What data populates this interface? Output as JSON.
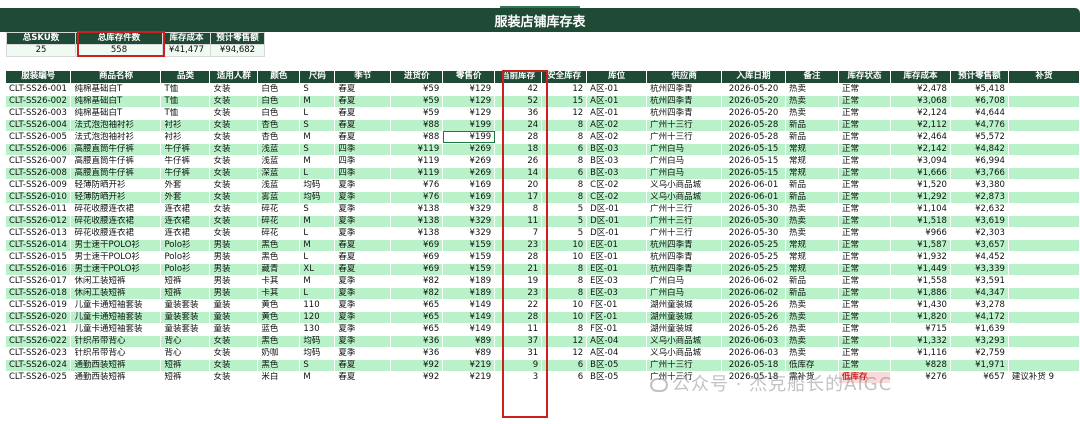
{
  "title": "服装店铺库存表",
  "summary": {
    "headers": [
      "总SKU数",
      "总库存件数",
      "库存成本",
      "预计零售额"
    ],
    "values": [
      "25",
      "558",
      "¥41,477",
      "¥94,682"
    ]
  },
  "columns": [
    "服装编号",
    "商品名称",
    "品类",
    "适用人群",
    "颜色",
    "尺码",
    "季节",
    "进货价",
    "零售价",
    "当前库存",
    "安全库存",
    "库位",
    "供应商",
    "入库日期",
    "备注",
    "库存状态",
    "库存成本",
    "预计零售额",
    "补货"
  ],
  "rows": [
    [
      "CLT-SS26-001",
      "纯棉基础白T",
      "T恤",
      "女装",
      "白色",
      "S",
      "春夏",
      "¥59",
      "¥129",
      "42",
      "12",
      "A区-01",
      "杭州四季青",
      "2026-05-20",
      "热卖",
      "正常",
      "¥2,478",
      "¥5,418",
      ""
    ],
    [
      "CLT-SS26-002",
      "纯棉基础白T",
      "T恤",
      "女装",
      "白色",
      "M",
      "春夏",
      "¥59",
      "¥129",
      "52",
      "15",
      "A区-01",
      "杭州四季青",
      "2026-05-20",
      "热卖",
      "正常",
      "¥3,068",
      "¥6,708",
      ""
    ],
    [
      "CLT-SS26-003",
      "纯棉基础白T",
      "T恤",
      "女装",
      "白色",
      "L",
      "春夏",
      "¥59",
      "¥129",
      "36",
      "12",
      "A区-01",
      "杭州四季青",
      "2026-05-20",
      "热卖",
      "正常",
      "¥2,124",
      "¥4,644",
      ""
    ],
    [
      "CLT-SS26-004",
      "法式泡泡袖衬衫",
      "衬衫",
      "女装",
      "杏色",
      "S",
      "春夏",
      "¥88",
      "¥199",
      "24",
      "8",
      "A区-02",
      "广州十三行",
      "2026-05-28",
      "新品",
      "正常",
      "¥2,112",
      "¥4,776",
      ""
    ],
    [
      "CLT-SS26-005",
      "法式泡泡袖衬衫",
      "衬衫",
      "女装",
      "杏色",
      "M",
      "春夏",
      "¥88",
      "¥199",
      "28",
      "8",
      "A区-02",
      "广州十三行",
      "2026-05-28",
      "新品",
      "正常",
      "¥2,464",
      "¥5,572",
      ""
    ],
    [
      "CLT-SS26-006",
      "高腰直筒牛仔裤",
      "牛仔裤",
      "女装",
      "浅蓝",
      "S",
      "四季",
      "¥119",
      "¥269",
      "18",
      "6",
      "B区-03",
      "广州白马",
      "2026-05-15",
      "常规",
      "正常",
      "¥2,142",
      "¥4,842",
      ""
    ],
    [
      "CLT-SS26-007",
      "高腰直筒牛仔裤",
      "牛仔裤",
      "女装",
      "浅蓝",
      "M",
      "四季",
      "¥119",
      "¥269",
      "26",
      "8",
      "B区-03",
      "广州白马",
      "2026-05-15",
      "常规",
      "正常",
      "¥3,094",
      "¥6,994",
      ""
    ],
    [
      "CLT-SS26-008",
      "高腰直筒牛仔裤",
      "牛仔裤",
      "女装",
      "深蓝",
      "L",
      "四季",
      "¥119",
      "¥269",
      "14",
      "6",
      "B区-03",
      "广州白马",
      "2026-05-15",
      "常规",
      "正常",
      "¥1,666",
      "¥3,766",
      ""
    ],
    [
      "CLT-SS26-009",
      "轻薄防晒开衫",
      "外套",
      "女装",
      "浅蓝",
      "均码",
      "夏季",
      "¥76",
      "¥169",
      "20",
      "8",
      "C区-02",
      "义乌小商品城",
      "2026-06-01",
      "新品",
      "正常",
      "¥1,520",
      "¥3,380",
      ""
    ],
    [
      "CLT-SS26-010",
      "轻薄防晒开衫",
      "外套",
      "女装",
      "雾蓝",
      "均码",
      "夏季",
      "¥76",
      "¥169",
      "17",
      "8",
      "C区-02",
      "义乌小商品城",
      "2026-06-01",
      "新品",
      "正常",
      "¥1,292",
      "¥2,873",
      ""
    ],
    [
      "CLT-SS26-011",
      "碎花收腰连衣裙",
      "连衣裙",
      "女装",
      "碎花",
      "S",
      "夏季",
      "¥138",
      "¥329",
      "8",
      "5",
      "D区-01",
      "广州十三行",
      "2026-05-30",
      "热卖",
      "正常",
      "¥1,104",
      "¥2,632",
      ""
    ],
    [
      "CLT-SS26-012",
      "碎花收腰连衣裙",
      "连衣裙",
      "女装",
      "碎花",
      "M",
      "夏季",
      "¥138",
      "¥329",
      "11",
      "5",
      "D区-01",
      "广州十三行",
      "2026-05-30",
      "热卖",
      "正常",
      "¥1,518",
      "¥3,619",
      ""
    ],
    [
      "CLT-SS26-013",
      "碎花收腰连衣裙",
      "连衣裙",
      "女装",
      "碎花",
      "L",
      "夏季",
      "¥138",
      "¥329",
      "7",
      "5",
      "D区-01",
      "广州十三行",
      "2026-05-30",
      "热卖",
      "正常",
      "¥966",
      "¥2,303",
      ""
    ],
    [
      "CLT-SS26-014",
      "男士速干POLO衫",
      "Polo衫",
      "男装",
      "黑色",
      "M",
      "春夏",
      "¥69",
      "¥159",
      "23",
      "10",
      "E区-01",
      "杭州四季青",
      "2026-05-25",
      "常规",
      "正常",
      "¥1,587",
      "¥3,657",
      ""
    ],
    [
      "CLT-SS26-015",
      "男士速干POLO衫",
      "Polo衫",
      "男装",
      "黑色",
      "L",
      "春夏",
      "¥69",
      "¥159",
      "28",
      "10",
      "E区-01",
      "杭州四季青",
      "2026-05-25",
      "常规",
      "正常",
      "¥1,932",
      "¥4,452",
      ""
    ],
    [
      "CLT-SS26-016",
      "男士速干POLO衫",
      "Polo衫",
      "男装",
      "藏青",
      "XL",
      "春夏",
      "¥69",
      "¥159",
      "21",
      "8",
      "E区-01",
      "杭州四季青",
      "2026-05-25",
      "常规",
      "正常",
      "¥1,449",
      "¥3,339",
      ""
    ],
    [
      "CLT-SS26-017",
      "休闲工装短裤",
      "短裤",
      "男装",
      "卡其",
      "M",
      "夏季",
      "¥82",
      "¥189",
      "19",
      "8",
      "E区-03",
      "广州白马",
      "2026-06-02",
      "新品",
      "正常",
      "¥1,558",
      "¥3,591",
      ""
    ],
    [
      "CLT-SS26-018",
      "休闲工装短裤",
      "短裤",
      "男装",
      "卡其",
      "L",
      "夏季",
      "¥82",
      "¥189",
      "23",
      "8",
      "E区-03",
      "广州白马",
      "2026-06-02",
      "新品",
      "正常",
      "¥1,886",
      "¥4,347",
      ""
    ],
    [
      "CLT-SS26-019",
      "儿童卡通短袖套装",
      "童装套装",
      "童装",
      "黄色",
      "110",
      "夏季",
      "¥65",
      "¥149",
      "22",
      "10",
      "F区-01",
      "湖州童装城",
      "2026-05-26",
      "热卖",
      "正常",
      "¥1,430",
      "¥3,278",
      ""
    ],
    [
      "CLT-SS26-020",
      "儿童卡通短袖套装",
      "童装套装",
      "童装",
      "黄色",
      "120",
      "夏季",
      "¥65",
      "¥149",
      "28",
      "10",
      "F区-01",
      "湖州童装城",
      "2026-05-26",
      "热卖",
      "正常",
      "¥1,820",
      "¥4,172",
      ""
    ],
    [
      "CLT-SS26-021",
      "儿童卡通短袖套装",
      "童装套装",
      "童装",
      "蓝色",
      "130",
      "夏季",
      "¥65",
      "¥149",
      "11",
      "8",
      "F区-01",
      "湖州童装城",
      "2026-05-26",
      "热卖",
      "正常",
      "¥715",
      "¥1,639",
      ""
    ],
    [
      "CLT-SS26-022",
      "针织吊带背心",
      "背心",
      "女装",
      "黑色",
      "均码",
      "夏季",
      "¥36",
      "¥89",
      "37",
      "12",
      "A区-04",
      "义乌小商品城",
      "2026-06-03",
      "热卖",
      "正常",
      "¥1,332",
      "¥3,293",
      ""
    ],
    [
      "CLT-SS26-023",
      "针织吊带背心",
      "背心",
      "女装",
      "奶咖",
      "均码",
      "夏季",
      "¥36",
      "¥89",
      "31",
      "12",
      "A区-04",
      "义乌小商品城",
      "2026-06-03",
      "热卖",
      "正常",
      "¥1,116",
      "¥2,759",
      ""
    ],
    [
      "CLT-SS26-024",
      "通勤西装短裤",
      "短裤",
      "女装",
      "黑色",
      "S",
      "春夏",
      "¥92",
      "¥219",
      "9",
      "6",
      "B区-05",
      "广州十三行",
      "2026-05-18",
      "低库存",
      "正常",
      "¥828",
      "¥1,971",
      ""
    ],
    [
      "CLT-SS26-025",
      "通勤西装短裤",
      "短裤",
      "女装",
      "米白",
      "M",
      "春夏",
      "¥92",
      "¥219",
      "3",
      "6",
      "B区-05",
      "广州十三行",
      "2026-05-18",
      "需补货",
      "低库存",
      "¥276",
      "¥657",
      "建议补货 9"
    ]
  ],
  "watermark": "公众号 · 杰克船长的AIGC",
  "colors": {
    "header": "#1e4a36",
    "band": "#b9f2c9",
    "alert": "#cc1f1f"
  }
}
